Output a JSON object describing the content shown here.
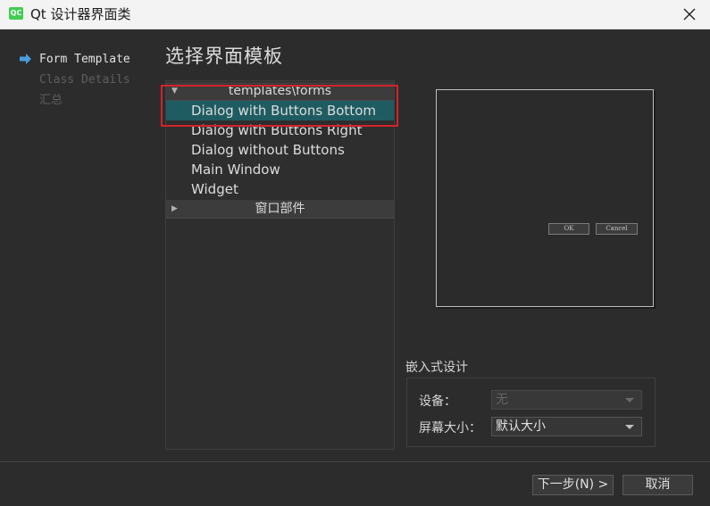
{
  "window": {
    "app_icon_text": "QC",
    "title": "Qt 设计器界面类"
  },
  "wizard": {
    "steps": [
      "Form Template",
      "Class Details",
      "汇总"
    ],
    "current_step": 0
  },
  "page": {
    "heading": "选择界面模板"
  },
  "templates": {
    "group1": {
      "label": "templates\\forms",
      "expanded": true,
      "items": [
        "Dialog with Buttons Bottom",
        "Dialog with Buttons Right",
        "Dialog without Buttons",
        "Main Window",
        "Widget"
      ]
    },
    "selected_item": "Dialog with Buttons Bottom",
    "group2": {
      "label": "窗口部件",
      "expanded": false
    }
  },
  "preview": {
    "ok_label": "OK",
    "cancel_label": "Cancel"
  },
  "embedded": {
    "title": "嵌入式设计",
    "device_label": "设备：",
    "device_value": "无",
    "screen_label": "屏幕大小：",
    "screen_value": "默认大小"
  },
  "footer": {
    "next_label": "下一步(N) >",
    "cancel_label": "取消"
  },
  "colors": {
    "selection": "#1f5c62",
    "highlight_box": "#d4232b",
    "step_arrow": "#4a9de0"
  }
}
